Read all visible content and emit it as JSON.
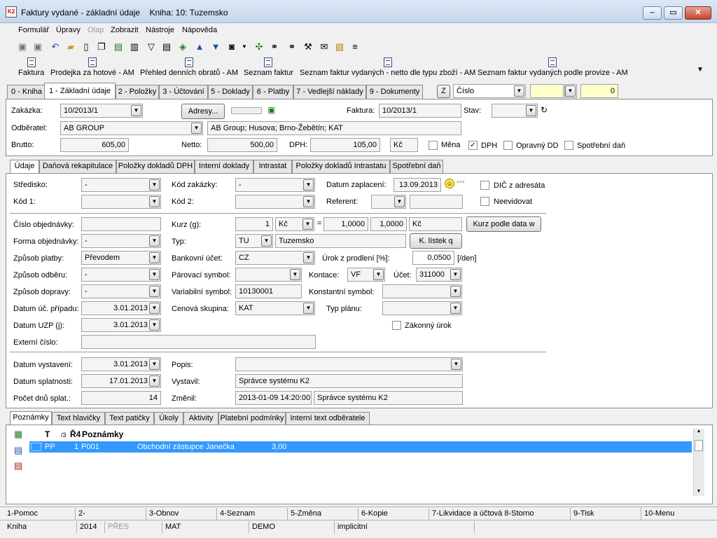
{
  "window": {
    "title": "Faktury vydané - základní údaje",
    "kniha": "Kniha: 10: Tuzemsko",
    "logo": "K2"
  },
  "menu": [
    "Formulář",
    "Úpravy",
    "Olap",
    "Zobrazit",
    "Nástroje",
    "Nápověda"
  ],
  "big_toolbar": [
    "Faktura",
    "Prodejka za hotové - AM",
    "Přehled denních obratů - AM",
    "Seznam faktur",
    "Seznam faktur vydaných - netto dle typu zboží - AM",
    "Seznam faktur vydaných podle provize - AM"
  ],
  "tabs": [
    "0 - Kniha",
    "1 - Základní údaje",
    "2 - Položky",
    "3 - Účtování",
    "5 - Doklady",
    "6 - Platby",
    "7 - Vedlejší náklady",
    "9 - Dokumenty"
  ],
  "tab_tools": {
    "z_label": "Z",
    "sort_by": "Číslo",
    "value": "0"
  },
  "header": {
    "zakazka_label": "Zakázka:",
    "zakazka": "10/2013/1",
    "adresy_button": "Adresy...",
    "faktura_label": "Faktura:",
    "faktura": "10/2013/1",
    "stav_label": "Stav:",
    "stav": "",
    "odberatel_label": "Odběratel:",
    "odberatel": "AB GROUP",
    "odberatel_addr": "AB Group; Husova; Brno-Žebětín; KAT",
    "brutto_label": "Brutto:",
    "brutto": "605,00",
    "netto_label": "Netto:",
    "netto": "500,00",
    "dph_label": "DPH:",
    "dph": "105,00",
    "mena_code": "Kč",
    "chk_mena": "Měna",
    "chk_dph": "DPH",
    "chk_opravny": "Opravný DD",
    "chk_spotrebni": "Spotřební daň"
  },
  "subtabs": [
    "Údaje",
    "Daňová rekapitulace",
    "Položky dokladů DPH",
    "Interní doklady",
    "Intrastat",
    "Položky dokladů Intrastatu",
    "Spotřební daň"
  ],
  "form": {
    "stredisko_label": "Středisko:",
    "stredisko": "-",
    "kod_zakazky_label": "Kód zakázky:",
    "kod_zakazky": "-",
    "datum_zaplaceni_label": "Datum zaplacení:",
    "datum_zaplaceni": "13.09.2013",
    "dic_label": "DIČ z adresáta",
    "kod1_label": "Kód 1:",
    "kod1": "",
    "kod2_label": "Kód 2:",
    "kod2": "",
    "referent_label": "Referent:",
    "referent": "",
    "neevidovat_label": "Neevidovat",
    "cislo_obj_label": "Číslo objednávky:",
    "cislo_obj": "",
    "kurz_label": "Kurz (g):",
    "kurz": "1",
    "kurz_mena": "Kč",
    "kurz_val1": "1,0000",
    "kurz_val2": "1,0000",
    "kurz_mena2": "Kč",
    "kurz_button": "Kurz podle data w",
    "forma_obj_label": "Forma objednávky:",
    "forma_obj": "-",
    "typ_label": "Typ:",
    "typ": "TU",
    "typ_name": "Tuzemsko",
    "kl_button": "K. lístek q",
    "zpusob_platby_label": "Způsob platby:",
    "zpusob_platby": "Převodem",
    "bank_ucet_label": "Bankovní účet:",
    "bank_ucet": "CZ",
    "urok_label": "Úrok z prodlení [%]:",
    "urok": "0,0500",
    "urok_unit": "[/den]",
    "zpusob_odberu_label": "Způsob odběru:",
    "zpusob_odberu": "-",
    "parovaci_label": "Párovací symbol:",
    "parovaci": "",
    "kontace_label": "Kontace:",
    "kontace": "VF",
    "ucet_label": "Účet:",
    "ucet": "311000",
    "zpusob_dopravy_label": "Způsob dopravy:",
    "zpusob_dopravy": "-",
    "variabilni_label": "Variabilní symbol:",
    "variabilni": "10130001",
    "konstantni_label": "Konstantní symbol:",
    "konstantni": "",
    "datum_uc_label": "Datum úč. případu:",
    "datum_uc": "3.01.2013",
    "cenova_label": "Cenová skupina:",
    "cenova": "KAT",
    "typ_planu_label": "Typ plánu:",
    "typ_planu": "",
    "datum_uzp_label": "Datum UZP (j):",
    "datum_uzp": "3.01.2013",
    "zakonny_label": "Zákonný úrok",
    "externi_label": "Externí číslo:",
    "externi": "",
    "datum_vyst_label": "Datum vystavení:",
    "datum_vyst": "3.01.2013",
    "popis_label": "Popis:",
    "popis": "",
    "datum_splat_label": "Datum splatnosti:",
    "datum_splat": "17.01.2013",
    "vystavil_label": "Vystavil:",
    "vystavil": "Správce systému K2",
    "pocet_dnu_label": "Počet dnů splat.:",
    "pocet_dnu": "14",
    "zmenil_label": "Změnil:",
    "zmenil_date": "2013-01-09 14:20:00",
    "zmenil": "Správce systému K2"
  },
  "bottom_tabs": [
    "Poznámky",
    "Text hlavičky",
    "Text patičky",
    "Úkoly",
    "Aktivity",
    "Platební podmínky",
    "Interní text odběratele"
  ],
  "notes_table": {
    "headers": [
      "T",
      "/3",
      "Ř4",
      "Poznámky"
    ],
    "rows": [
      {
        "t": "PP",
        "n": "1",
        "code": "P001",
        "text": "Obchodní zástupce Janečka",
        "val": "3,00"
      }
    ]
  },
  "fkeys": [
    "1-Pomoc",
    "2-",
    "3-Obnov",
    "4-Seznam",
    "5-Změna",
    "6-Kopie",
    "7-Likvidace a účtová 8-Storno",
    "9-Tisk",
    "10-Menu"
  ],
  "status": [
    "Kniha",
    "2014",
    "PŘES",
    "MAT",
    "DEMO",
    "implicitní"
  ]
}
